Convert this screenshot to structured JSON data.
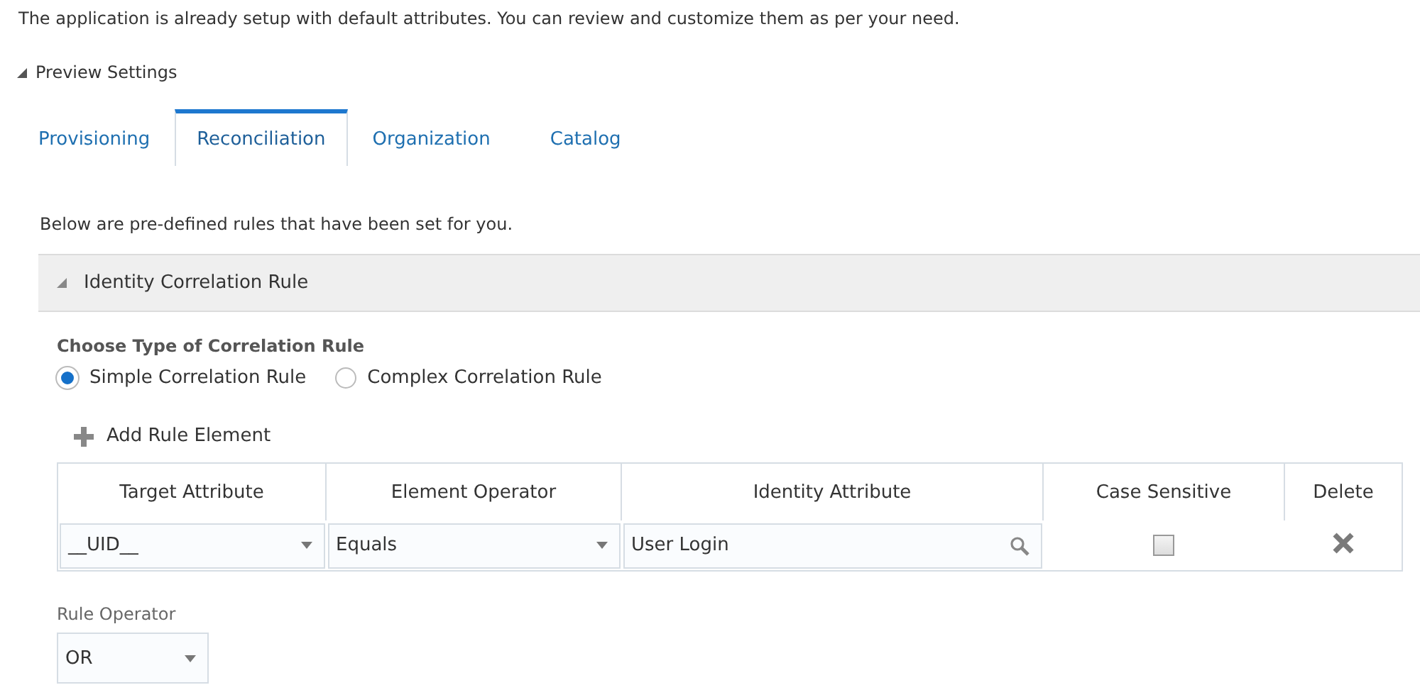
{
  "intro": "The application is already setup with default attributes. You can review and customize them as per your need.",
  "preview_settings": {
    "label": "Preview Settings",
    "expanded": true
  },
  "tabs": [
    {
      "label": "Provisioning",
      "selected": false
    },
    {
      "label": "Reconciliation",
      "selected": true
    },
    {
      "label": "Organization",
      "selected": false
    },
    {
      "label": "Catalog",
      "selected": false
    }
  ],
  "description": "Below are pre-defined rules that have been set for you.",
  "section": {
    "title": "Identity Correlation Rule",
    "expanded": true
  },
  "rule_type": {
    "label": "Choose Type of Correlation Rule",
    "options": [
      {
        "label": "Simple Correlation Rule",
        "selected": true
      },
      {
        "label": "Complex Correlation Rule",
        "selected": false
      }
    ]
  },
  "add_button": "Add Rule Element",
  "table": {
    "columns": [
      "Target Attribute",
      "Element Operator",
      "Identity Attribute",
      "Case Sensitive",
      "Delete"
    ],
    "rows": [
      {
        "target_attribute": "__UID__",
        "element_operator": "Equals",
        "identity_attribute": "User Login",
        "case_sensitive": false
      }
    ]
  },
  "rule_operator": {
    "label": "Rule Operator",
    "value": "OR"
  }
}
